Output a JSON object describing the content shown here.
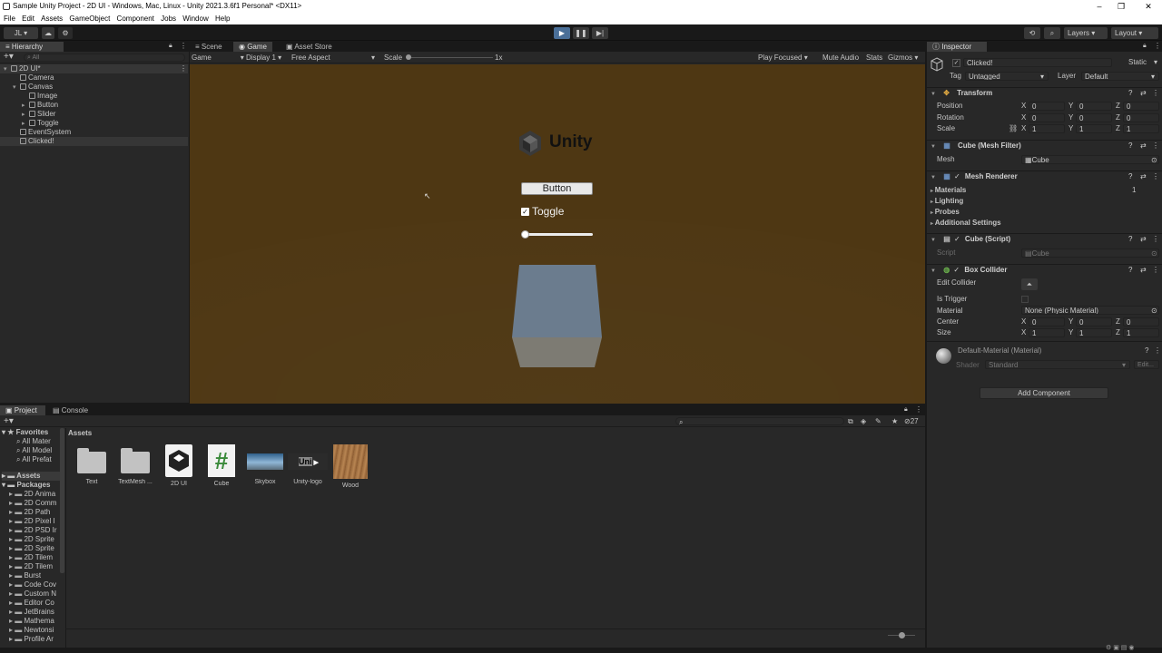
{
  "window": {
    "title": "Sample Unity Project - 2D UI - Windows, Mac, Linux - Unity 2021.3.6f1 Personal* <DX11>",
    "controls": [
      "–",
      "❐",
      "✕"
    ]
  },
  "menubar": [
    "File",
    "Edit",
    "Assets",
    "GameObject",
    "Component",
    "Jobs",
    "Window",
    "Help"
  ],
  "toolbar": {
    "account": "JL ▾",
    "play_icon": "play-icon",
    "pause_icon": "pause-icon",
    "step_icon": "step-icon",
    "layers": "Layers",
    "layout": "Layout"
  },
  "hierarchy": {
    "tab": "Hierarchy",
    "search_placeholder": "All",
    "items": [
      {
        "label": "2D UI*",
        "indent": 0
      },
      {
        "label": "Camera",
        "indent": 1
      },
      {
        "label": "Canvas",
        "indent": 1
      },
      {
        "label": "Image",
        "indent": 2
      },
      {
        "label": "Button",
        "indent": 2
      },
      {
        "label": "Slider",
        "indent": 2
      },
      {
        "label": "Toggle",
        "indent": 2
      },
      {
        "label": "EventSystem",
        "indent": 1
      },
      {
        "label": "Clicked!",
        "indent": 1
      }
    ]
  },
  "game": {
    "tabs": [
      "Scene",
      "Game",
      "Asset Store"
    ],
    "toolbar": {
      "game": "Game",
      "display": "Display 1",
      "aspect": "Free Aspect",
      "scale_label": "Scale",
      "scale_value": "1x",
      "play_focused": "Play Focused",
      "mute": "Mute Audio",
      "stats": "Stats",
      "gizmos": "Gizmos"
    },
    "view": {
      "logo_text": "Unity",
      "button_label": "Button",
      "toggle_label": "Toggle",
      "toggle_checked": true,
      "slider_value": 0,
      "background_color": "#4e3713",
      "cube_color": "#657585"
    }
  },
  "inspector": {
    "tab": "Inspector",
    "object_name": "Clicked!",
    "static": "Static",
    "tag_label": "Tag",
    "tag_value": "Untagged",
    "layer_label": "Layer",
    "layer_value": "Default",
    "transform": {
      "title": "Transform",
      "rows": [
        {
          "label": "Position",
          "x": "0",
          "y": "0",
          "z": "0"
        },
        {
          "label": "Rotation",
          "x": "0",
          "y": "0",
          "z": "0"
        },
        {
          "label": "Scale",
          "x": "1",
          "y": "1",
          "z": "1"
        }
      ]
    },
    "mesh_filter": {
      "title": "Cube (Mesh Filter)",
      "mesh_label": "Mesh",
      "mesh_value": "Cube"
    },
    "mesh_renderer": {
      "title": "Mesh Renderer",
      "sections": [
        "Materials",
        "Lighting",
        "Probes",
        "Additional Settings"
      ],
      "materials_count": "1"
    },
    "script": {
      "title": "Cube (Script)",
      "script_label": "Script",
      "script_value": "Cube"
    },
    "box_collider": {
      "title": "Box Collider",
      "edit_collider": "Edit Collider",
      "is_trigger": "Is Trigger",
      "material_label": "Material",
      "material_value": "None (Physic Material)",
      "center_label": "Center",
      "center": {
        "x": "0",
        "y": "0",
        "z": "0"
      },
      "size_label": "Size",
      "size": {
        "x": "1",
        "y": "1",
        "z": "1"
      }
    },
    "material": {
      "name": "Default-Material (Material)",
      "shader_label": "Shader",
      "shader_value": "Standard",
      "edit": "Edit..."
    },
    "add_component": "Add Component",
    "axes": [
      "X",
      "Y",
      "Z"
    ]
  },
  "project": {
    "tabs": [
      "Project",
      "Console"
    ],
    "favorites_label": "Favorites",
    "favorites": [
      "All Mater",
      "All Model",
      "All Prefat"
    ],
    "assets_label": "Assets",
    "packages_label": "Packages",
    "packages": [
      "2D Anima",
      "2D Comm",
      "2D Path",
      "2D Pixel I",
      "2D PSD Ir",
      "2D Sprite",
      "2D Sprite",
      "2D Tilem",
      "2D Tilem",
      "Burst",
      "Code Cov",
      "Custom N",
      "Editor Co",
      "JetBrains",
      "Mathema",
      "Newtonsi",
      "Profile Ar"
    ],
    "breadcrumb": "Assets",
    "count": "27",
    "assets": [
      {
        "name": "Text",
        "kind": "folder"
      },
      {
        "name": "TextMesh ...",
        "kind": "folder"
      },
      {
        "name": "2D UI",
        "kind": "scene"
      },
      {
        "name": "Cube",
        "kind": "script"
      },
      {
        "name": "Skybox",
        "kind": "skybox"
      },
      {
        "name": "Unity-logo",
        "kind": "logo"
      },
      {
        "name": "Wood",
        "kind": "texture"
      }
    ],
    "logo_thumb_text": "Uni"
  }
}
